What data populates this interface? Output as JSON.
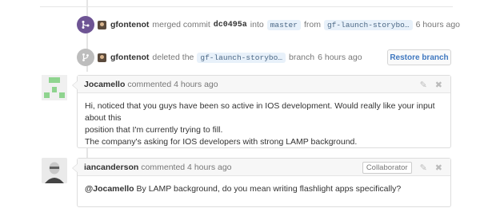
{
  "events": [
    {
      "icon": "merge-icon",
      "user": "gfontenot",
      "action": "merged commit",
      "sha": "dc0495a",
      "into_text": "into",
      "target_branch": "master",
      "from_text": "from",
      "source_branch": "gf-launch-storybo…",
      "time": "6 hours ago"
    },
    {
      "icon": "branch-icon",
      "user": "gfontenot",
      "action": "deleted the",
      "branch": "gf-launch-storybo…",
      "branch_text": "branch",
      "time": "6 hours ago",
      "button_label": "Restore branch"
    }
  ],
  "comments": [
    {
      "author": "Jocamello",
      "meta": "commented 4 hours ago",
      "lines": [
        "Hi, noticed that you guys have been so active in IOS development. Would really like your input about this",
        "position that I'm currently trying to fill.",
        "The company's asking for IOS developers with strong LAMP background."
      ]
    },
    {
      "author": "iancanderson",
      "meta": "commented 4 hours ago",
      "badge": "Collaborator",
      "mention": "@Jocamello",
      "text": " By LAMP background, do you mean writing flashlight apps specifically?"
    }
  ],
  "colors": {
    "merged": "#6e5494",
    "link": "#4078c0",
    "branch_bg": "#e8f1fa"
  }
}
